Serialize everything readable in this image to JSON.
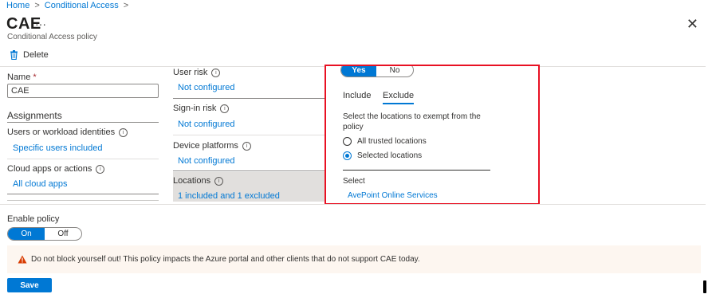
{
  "breadcrumb": {
    "home": "Home",
    "conditional_access": "Conditional Access",
    "sep": ">"
  },
  "header": {
    "title": "CAE",
    "more": "···",
    "subtitle": "Conditional Access policy",
    "close": "✕"
  },
  "toolbar": {
    "delete_label": "Delete"
  },
  "left": {
    "name_label": "Name",
    "required_mark": "*",
    "name_value": "CAE",
    "assignments_heading": "Assignments",
    "users_label": "Users or workload identities",
    "users_value": "Specific users included",
    "apps_label": "Cloud apps or actions",
    "apps_value": "All cloud apps"
  },
  "middle": {
    "user_risk_label": "User risk",
    "user_risk_value": "Not configured",
    "signin_risk_label": "Sign-in risk",
    "signin_risk_value": "Not configured",
    "device_platforms_label": "Device platforms",
    "device_platforms_value": "Not configured",
    "locations_label": "Locations",
    "locations_value": "1 included and 1 excluded"
  },
  "panel": {
    "toggle_yes": "Yes",
    "toggle_no": "No",
    "tab_include": "Include",
    "tab_exclude": "Exclude",
    "description": "Select the locations to exempt from the policy",
    "radio_all": "All trusted locations",
    "radio_selected": "Selected locations",
    "select_label": "Select",
    "selected_location": "AvePoint Online Services"
  },
  "enable_policy": {
    "label": "Enable policy",
    "on": "On",
    "off": "Off"
  },
  "warning": {
    "text": "Do not block yourself out! This policy impacts the Azure portal and other clients that do not support CAE today."
  },
  "footer": {
    "save_label": "Save"
  },
  "icons": {
    "info": "info-icon",
    "warning": "warning-icon",
    "delete": "trash-icon",
    "close": "close-icon"
  },
  "colors": {
    "accent": "#0078d4",
    "highlight_border": "#e81123",
    "warning_bg": "#fdf6f0",
    "warning_icon": "#d83b01"
  }
}
